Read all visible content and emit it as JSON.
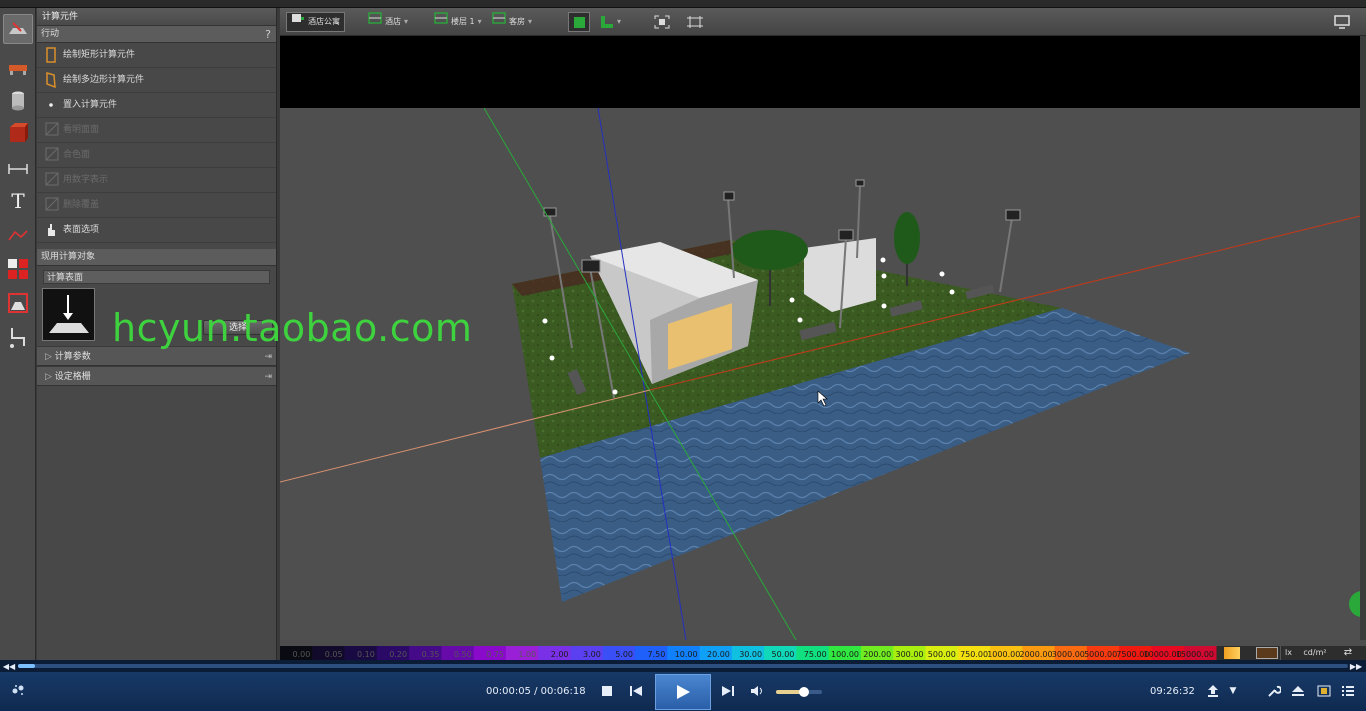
{
  "panel": {
    "title": "计算元件",
    "section_actions": "行动",
    "help": "?",
    "actions": [
      {
        "label": "绘制矩形计算元件",
        "enabled": true
      },
      {
        "label": "绘制多边形计算元件",
        "enabled": true
      },
      {
        "label": "置入计算元件",
        "enabled": true
      },
      {
        "label": "看明面面",
        "enabled": false
      },
      {
        "label": "合色面",
        "enabled": false
      },
      {
        "label": "用数字表示",
        "enabled": false
      },
      {
        "label": "删除覆盖",
        "enabled": false
      },
      {
        "label": "表面选项",
        "enabled": true
      }
    ],
    "section_current": "现用计算对象",
    "current_object": "计算表面",
    "select_button": "选择",
    "expander_params": "计算参数",
    "expander_grid": "设定格栅"
  },
  "viewport_toolbar": {
    "items": [
      {
        "label": "酒店公寓",
        "icon": "building-icon"
      },
      {
        "label": "酒店",
        "icon": "stack-icon"
      },
      {
        "label": "楼层 1",
        "icon": "floor-icon"
      },
      {
        "label": "客房",
        "icon": "room-icon"
      }
    ]
  },
  "legend": {
    "values": [
      "0.00",
      "0.05",
      "0.10",
      "0.20",
      "0.35",
      "0.50",
      "0.75",
      "1.00",
      "2.00",
      "3.00",
      "5.00",
      "7.50",
      "10.00",
      "20.00",
      "30.00",
      "50.00",
      "75.00",
      "100.00",
      "200.00",
      "300.00",
      "500.00",
      "750.00",
      "1000.00",
      "2000.00",
      "3000.00",
      "5000.00",
      "7500.00",
      "10000.00",
      "15000.00"
    ],
    "colors": [
      "#0a0a12",
      "#120a2a",
      "#1a0a44",
      "#2a0a66",
      "#440a88",
      "#660aaa",
      "#8a0acc",
      "#9a20d8",
      "#7a30e6",
      "#5a40f0",
      "#3a50f6",
      "#2060fa",
      "#1080fc",
      "#10a0f8",
      "#10c0e0",
      "#10d8b8",
      "#10e080",
      "#30e840",
      "#70ec20",
      "#a8ee10",
      "#d8ee10",
      "#f4e010",
      "#f8c010",
      "#fa9a10",
      "#fa6a10",
      "#f83a10",
      "#f01a10",
      "#e80a20",
      "#d00a30"
    ],
    "unit_lx": "lx",
    "unit_cd": "cd/m²"
  },
  "watermark": "hcyun.taobao.com",
  "player": {
    "time": "00:00:05 / 00:06:18",
    "clock": "09:26:32",
    "progress": 0.013,
    "volume": 0.6
  }
}
